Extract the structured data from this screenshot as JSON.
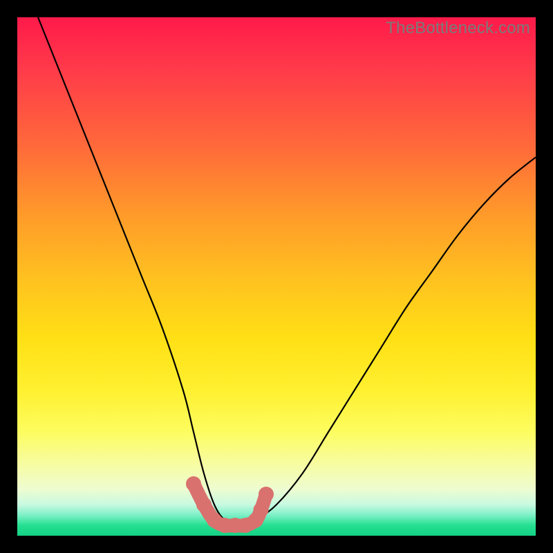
{
  "watermark": "TheBottleneck.com",
  "chart_data": {
    "type": "line",
    "title": "",
    "xlabel": "",
    "ylabel": "",
    "xlim": [
      0,
      100
    ],
    "ylim": [
      0,
      100
    ],
    "series": [
      {
        "name": "bottleneck-curve",
        "x": [
          4,
          8,
          12,
          16,
          20,
          24,
          28,
          32,
          34,
          36,
          38,
          40,
          42,
          44,
          46,
          50,
          55,
          60,
          65,
          70,
          75,
          80,
          85,
          90,
          95,
          100
        ],
        "y": [
          100,
          90,
          80,
          70,
          60,
          50,
          40,
          28,
          20,
          12,
          6,
          3,
          2,
          2,
          3,
          6,
          12,
          20,
          28,
          36,
          44,
          51,
          58,
          64,
          69,
          73
        ]
      }
    ],
    "highlight": {
      "name": "optimal-range",
      "x": [
        34,
        36,
        38,
        40,
        42,
        44,
        46,
        47,
        48
      ],
      "y": [
        10,
        6,
        3,
        2,
        2,
        2,
        3,
        5,
        8
      ],
      "color": "#d9716e"
    },
    "grid": false,
    "legend": false
  }
}
